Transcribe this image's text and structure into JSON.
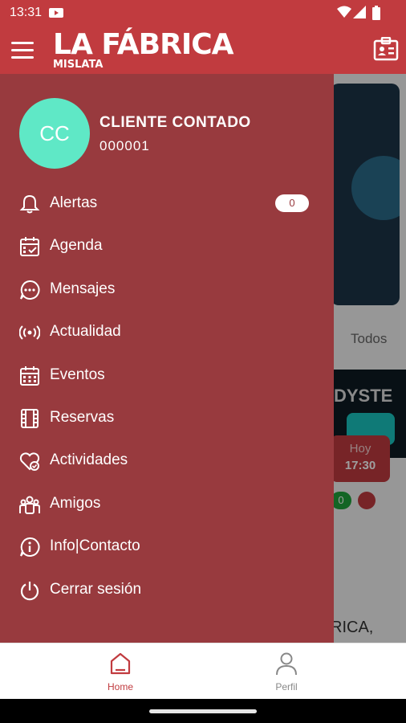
{
  "status": {
    "time": "13:31"
  },
  "app": {
    "logo_main": "LA FÁBRICA",
    "logo_sub": "MISLATA"
  },
  "user": {
    "initials": "CC",
    "name": "CLIENTE CONTADO",
    "code": "000001"
  },
  "menu": {
    "items": [
      {
        "label": "Alertas",
        "icon": "bell-icon",
        "badge": "0"
      },
      {
        "label": "Agenda",
        "icon": "calendar-check-icon"
      },
      {
        "label": "Mensajes",
        "icon": "chat-bubble-icon"
      },
      {
        "label": "Actualidad",
        "icon": "broadcast-icon"
      },
      {
        "label": "Eventos",
        "icon": "calendar-grid-icon"
      },
      {
        "label": "Reservas",
        "icon": "film-icon"
      },
      {
        "label": "Actividades",
        "icon": "heart-check-icon"
      },
      {
        "label": "Amigos",
        "icon": "group-icon"
      },
      {
        "label": "Info|Contacto",
        "icon": "info-icon"
      },
      {
        "label": "Cerrar sesión",
        "icon": "power-icon"
      }
    ]
  },
  "background": {
    "tab_todos": "Todos",
    "banner_text": "DYSTE",
    "chip_day": "Hoy",
    "chip_time": "17:30",
    "green_badge": "0",
    "partial_text": "RICA,"
  },
  "bottom_nav": {
    "home_label": "Home",
    "profile_label": "Perfil"
  },
  "colors": {
    "brand": "#c13b3f",
    "drawer": "#983a3e",
    "avatar": "#5fe8c6"
  }
}
